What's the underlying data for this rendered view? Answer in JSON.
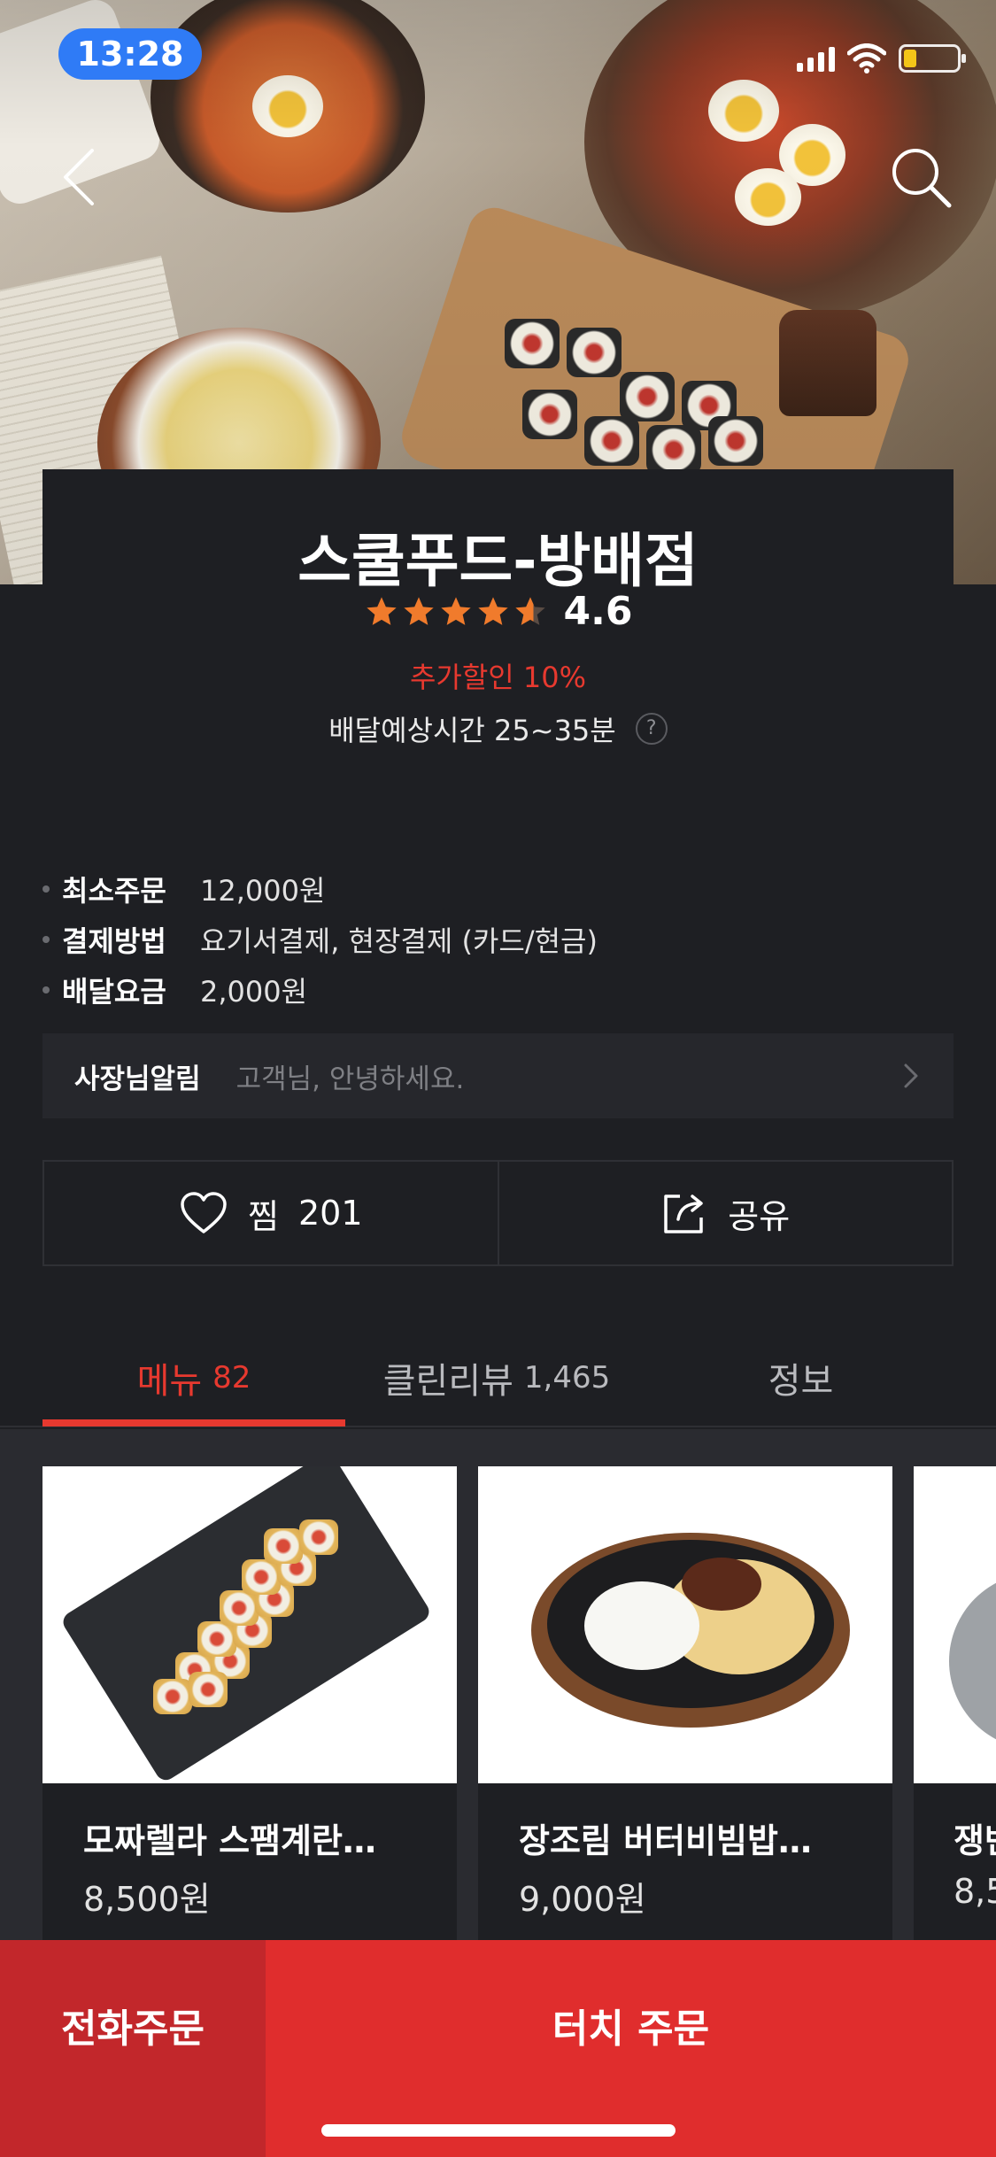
{
  "status_bar": {
    "time": "13:28"
  },
  "store": {
    "name": "스쿨푸드-방배점",
    "rating": "4.6",
    "stars_filled": 4.5,
    "discount": "추가할인 10%",
    "eta": "배달예상시간 25~35분",
    "help": "?"
  },
  "info": [
    {
      "label": "최소주문",
      "value": "12,000원"
    },
    {
      "label": "결제방법",
      "value": "요기서결제, 현장결제 (카드/현금)"
    },
    {
      "label": "배달요금",
      "value": "2,000원"
    }
  ],
  "notice": {
    "title": "사장님알림",
    "message": "고객님, 안녕하세요."
  },
  "actions": {
    "favorite_label": "찜",
    "favorite_count": "201",
    "share_label": "공유"
  },
  "tabs": [
    {
      "label": "메뉴",
      "count": "82"
    },
    {
      "label": "클린리뷰",
      "count": "1,465"
    },
    {
      "label": "정보",
      "count": ""
    }
  ],
  "menu": [
    {
      "name": "모짜렐라 스팸계란…",
      "price": "8,500원"
    },
    {
      "name": "장조림 버터비빔밥…",
      "price": "9,000원"
    },
    {
      "name": "쟁반",
      "price": "8,5"
    }
  ],
  "bottom": {
    "call": "전화주문",
    "order": "터치 주문"
  },
  "colors": {
    "accent": "#e7392f",
    "background": "#1e1f23",
    "order_button": "#e02d2d",
    "call_button": "#c2272b",
    "star": "#f07b2c"
  }
}
